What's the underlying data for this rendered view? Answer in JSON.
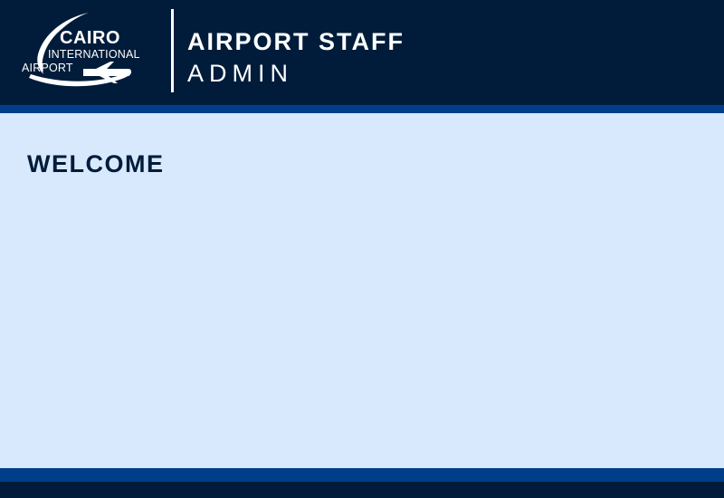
{
  "header": {
    "logo": {
      "line1": "CAIRO",
      "line2": "INTERNATIONAL",
      "line3": "AIRPORT",
      "icon": "airplane-swoosh-icon"
    },
    "title": "AIRPORT STAFF",
    "subtitle": "ADMIN"
  },
  "main": {
    "heading": "WELCOME"
  },
  "colors": {
    "header_bg": "#001c3a",
    "accent_stripe": "#003e8a",
    "content_bg": "#d8e9fd",
    "heading_text": "#001c3a"
  }
}
